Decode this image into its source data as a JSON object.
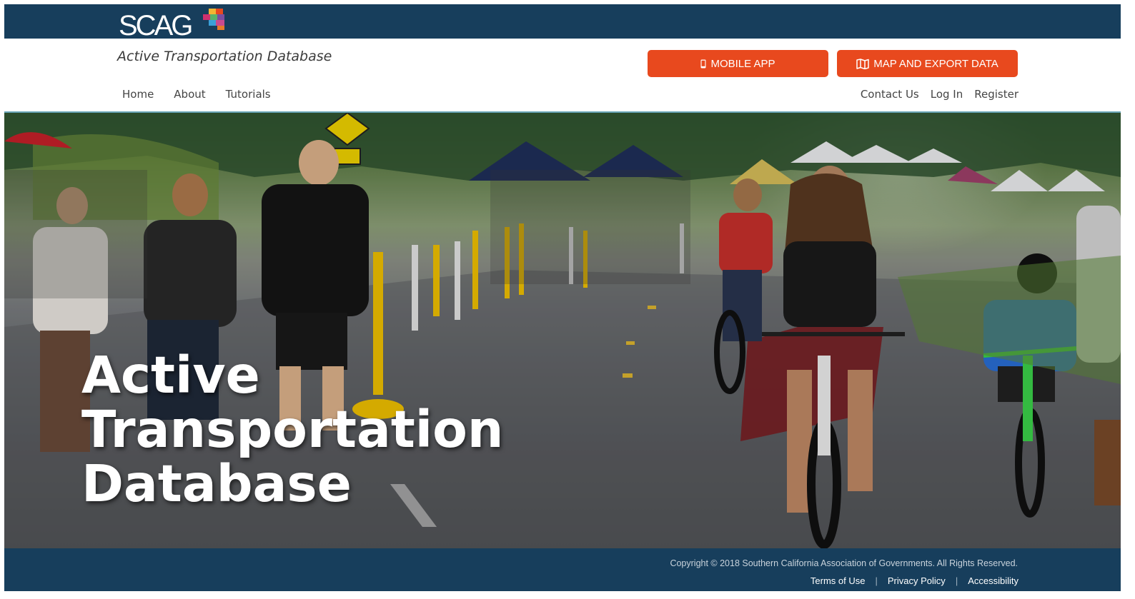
{
  "brand": {
    "logo_text": "SCAG",
    "subtitle": "Active Transportation Database"
  },
  "nav": {
    "left": [
      "Home",
      "About",
      "Tutorials"
    ],
    "right": [
      "Contact Us",
      "Log In",
      "Register"
    ]
  },
  "buttons": {
    "mobile_app": "MOBILE APP",
    "map_export": "MAP AND EXPORT DATA"
  },
  "hero": {
    "title_lines": [
      "Active",
      "Transportation",
      "Database"
    ]
  },
  "footer": {
    "copyright": "Copyright © 2018 Southern California Association of Governments. All Rights Reserved.",
    "links": [
      "Terms of Use",
      "Privacy Policy",
      "Accessibility"
    ]
  },
  "colors": {
    "topbar": "#173e5c",
    "accent": "#e8491e"
  },
  "icons": {
    "mobile": "mobile-phone-icon",
    "map": "map-icon"
  }
}
